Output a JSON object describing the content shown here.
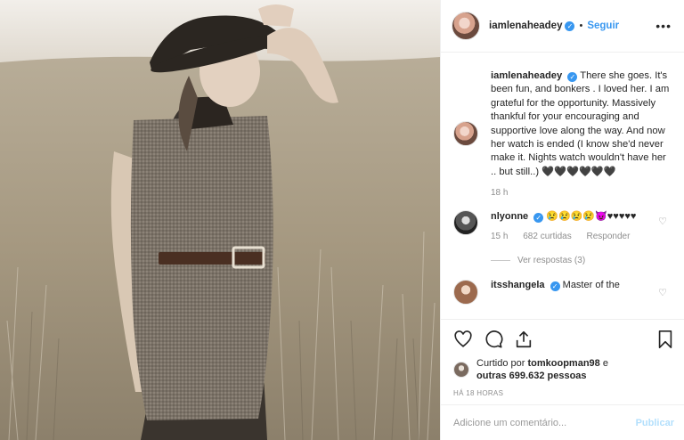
{
  "post": {
    "username": "iamlenaheadey",
    "follow_label": "Seguir",
    "caption": "There she goes. It's been fun, and bonkers . I loved her. I am grateful for the opportunity. Massively thankful for your encouraging and supportive love along the way. And now her watch is ended (I know she'd never make it. Nights watch wouldn't have her .. but still..) 🖤🖤🖤🖤🖤🖤",
    "caption_age": "18 h"
  },
  "comments": [
    {
      "username": "nlyonne",
      "text": "😢😢😢😢😈♥♥♥♥♥",
      "age": "15 h",
      "likes": "682 curtidas",
      "reply_label": "Responder",
      "view_replies": "Ver respostas (3)"
    },
    {
      "username": "itsshangela",
      "text": "Master of the"
    }
  ],
  "likes": {
    "prefix": "Curtido por",
    "user": "tomkoopman98",
    "middle": "e",
    "others": "outras 699.632 pessoas"
  },
  "timestamp": "HÁ 18 HORAS",
  "add_comment": {
    "placeholder": "Adicione um comentário...",
    "publish_label": "Publicar"
  },
  "icons": {
    "more": "more-options-icon",
    "like": "heart-icon",
    "comment": "comment-icon",
    "share": "share-icon",
    "save": "bookmark-icon",
    "verified": "verified-badge-icon"
  },
  "colors": {
    "link": "#3897f0",
    "verified": "#3897f0",
    "muted": "#8e8e8e",
    "publish_disabled": "#b2dffc"
  }
}
